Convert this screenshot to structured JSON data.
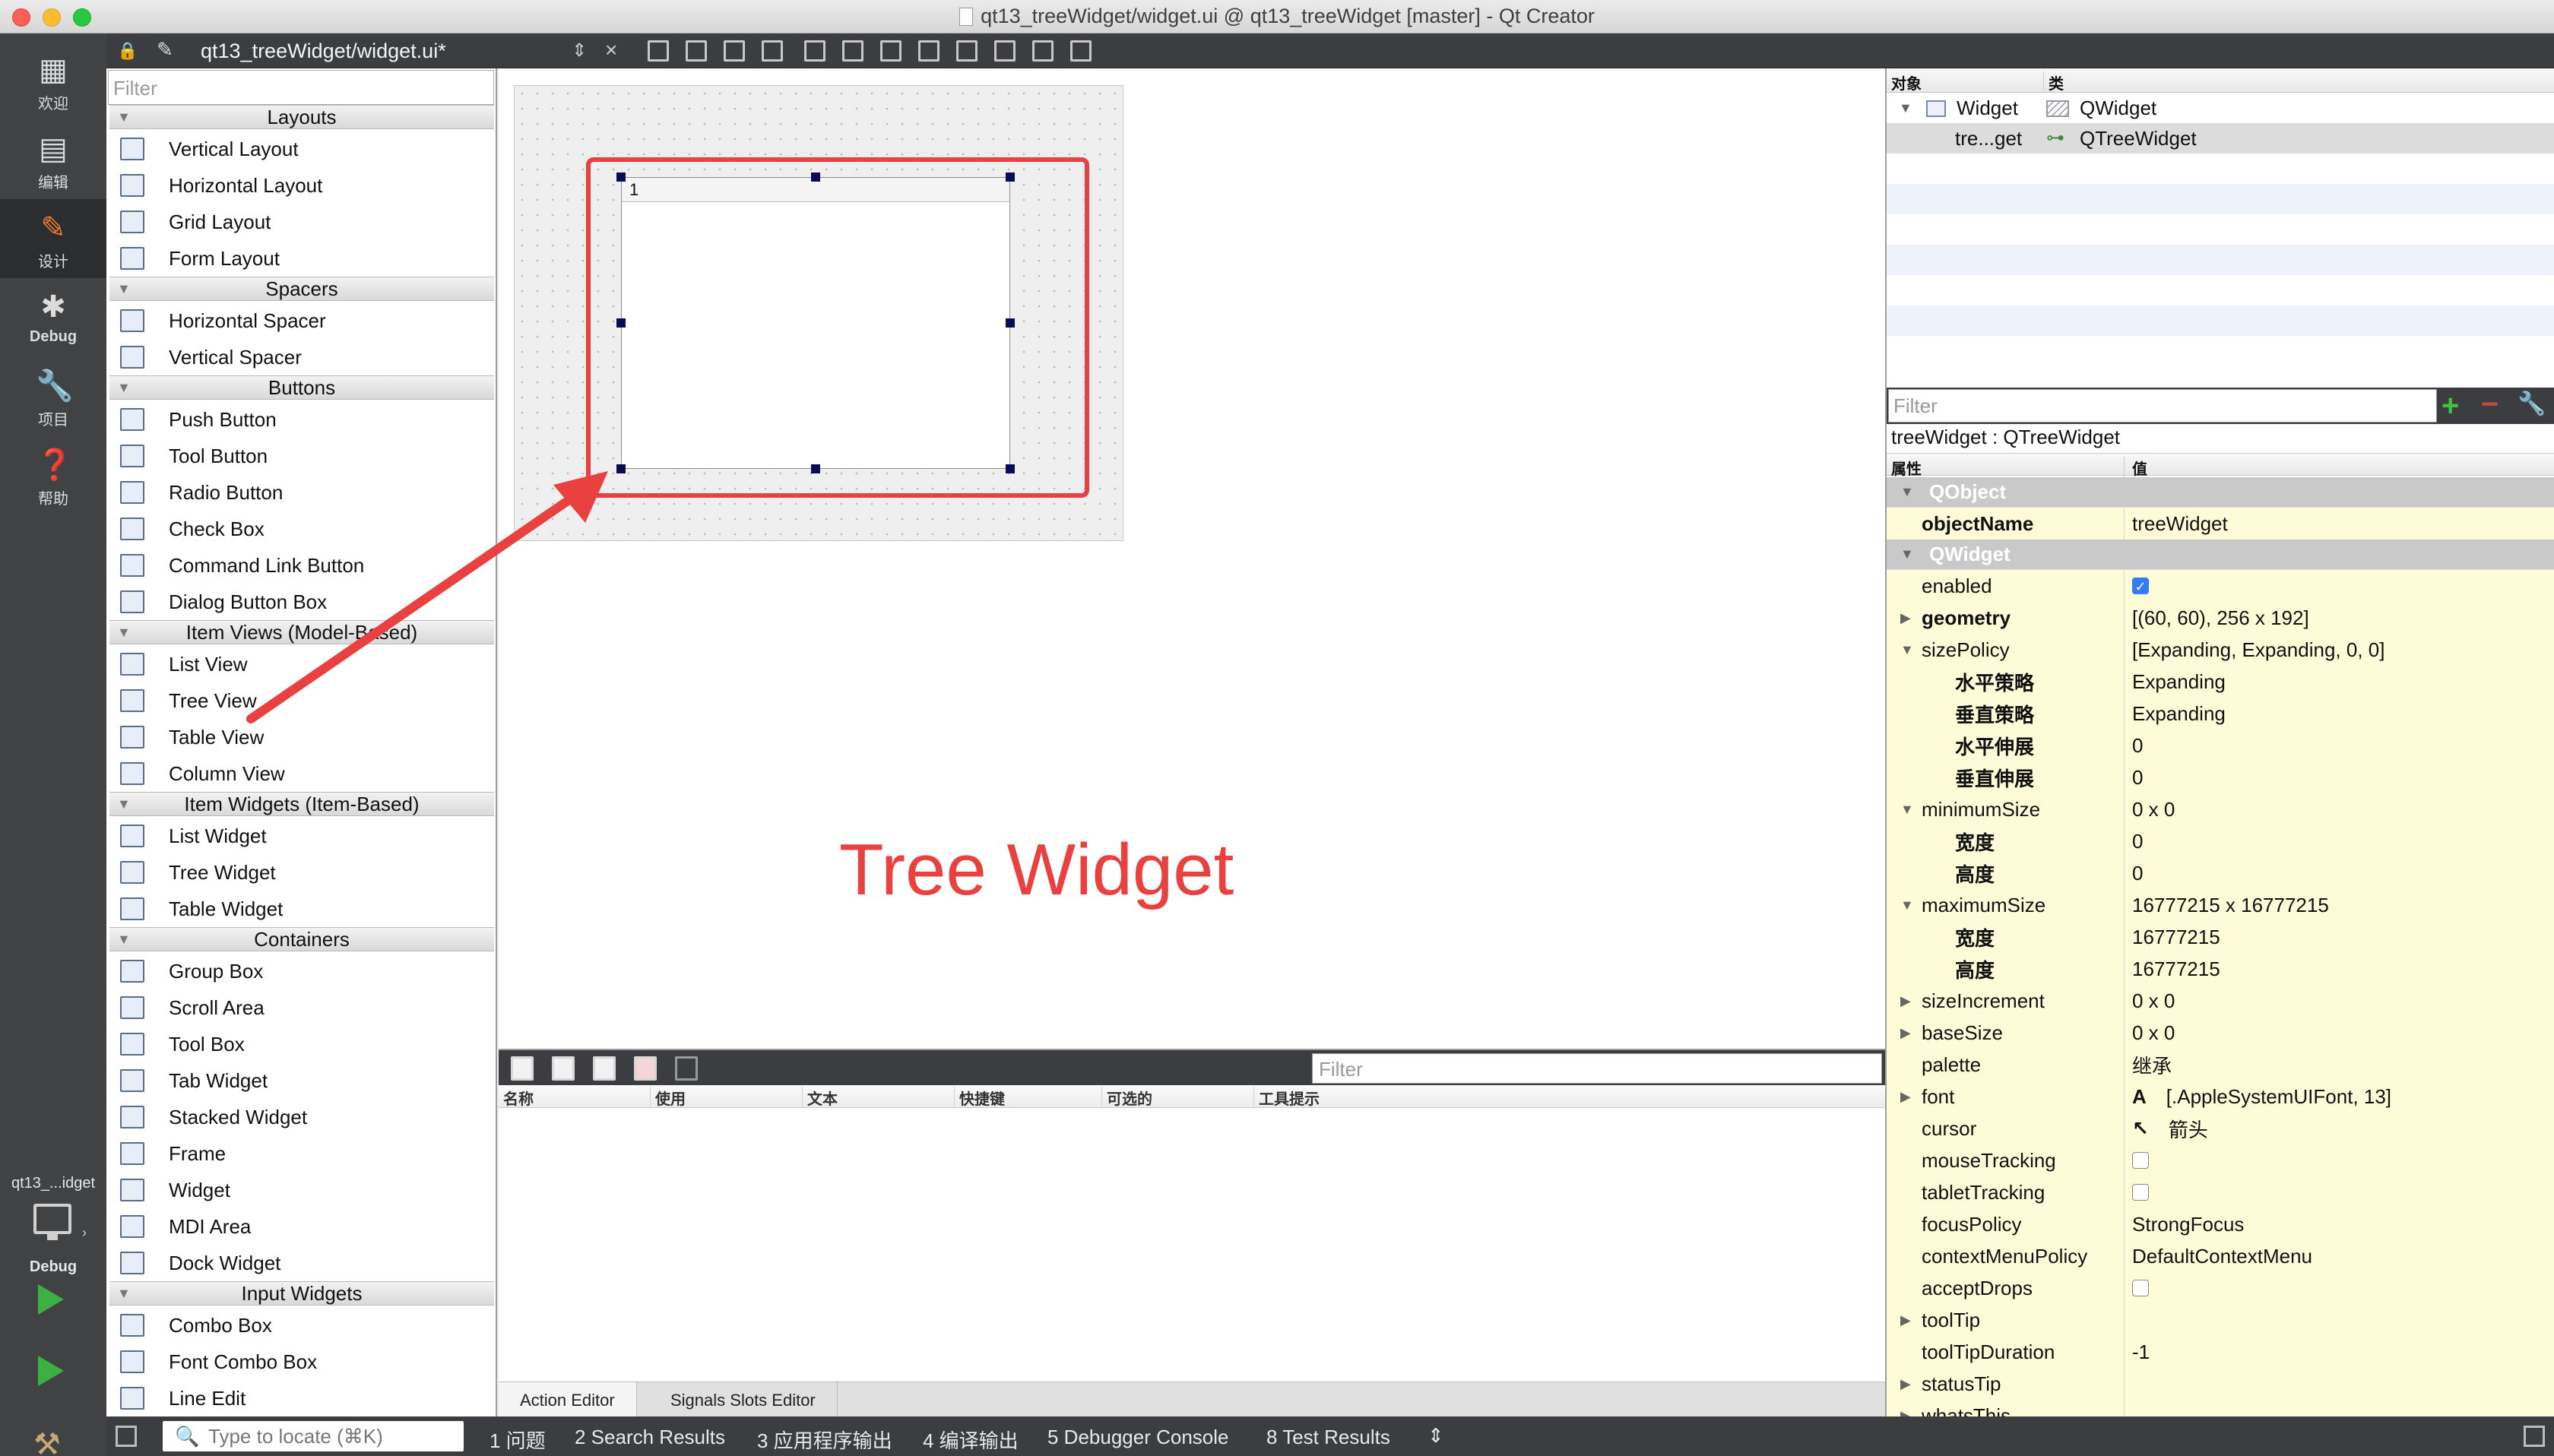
{
  "window": {
    "title": "qt13_treeWidget/widget.ui @ qt13_treeWidget [master] - Qt Creator"
  },
  "modebar": {
    "items": [
      {
        "label": "欢迎",
        "icon": "grid-icon"
      },
      {
        "label": "编辑",
        "icon": "document-icon"
      },
      {
        "label": "设计",
        "icon": "pencil-icon"
      },
      {
        "label": "Debug",
        "icon": "bug-icon"
      },
      {
        "label": "项目",
        "icon": "wrench-icon"
      },
      {
        "label": "帮助",
        "icon": "help-icon"
      }
    ],
    "kit_label": "qt13_...idget",
    "kit_mode": "Debug"
  },
  "toolbar": {
    "document": "qt13_treeWidget/widget.ui*"
  },
  "widgetbox": {
    "filter_placeholder": "Filter",
    "categories": [
      {
        "name": "Layouts",
        "items": [
          "Vertical Layout",
          "Horizontal Layout",
          "Grid Layout",
          "Form Layout"
        ]
      },
      {
        "name": "Spacers",
        "items": [
          "Horizontal Spacer",
          "Vertical Spacer"
        ]
      },
      {
        "name": "Buttons",
        "items": [
          "Push Button",
          "Tool Button",
          "Radio Button",
          "Check Box",
          "Command Link Button",
          "Dialog Button Box"
        ]
      },
      {
        "name": "Item Views (Model-Based)",
        "items": [
          "List View",
          "Tree View",
          "Table View",
          "Column View"
        ]
      },
      {
        "name": "Item Widgets (Item-Based)",
        "items": [
          "List Widget",
          "Tree Widget",
          "Table Widget"
        ]
      },
      {
        "name": "Containers",
        "items": [
          "Group Box",
          "Scroll Area",
          "Tool Box",
          "Tab Widget",
          "Stacked Widget",
          "Frame",
          "Widget",
          "MDI Area",
          "Dock Widget"
        ]
      },
      {
        "name": "Input Widgets",
        "items": [
          "Combo Box",
          "Font Combo Box",
          "Line Edit"
        ]
      }
    ]
  },
  "canvas": {
    "tree_header_col": "1",
    "annotation": "Tree Widget",
    "annotation_color": "#e8413f"
  },
  "action_editor": {
    "filter_placeholder": "Filter",
    "columns": [
      "名称",
      "使用",
      "文本",
      "快捷键",
      "可选的",
      "工具提示"
    ],
    "tabs": [
      "Action Editor",
      "Signals  Slots Editor"
    ]
  },
  "object_inspector": {
    "col_object": "对象",
    "col_class": "类",
    "rows": [
      {
        "object": "Widget",
        "class": "QWidget"
      },
      {
        "object": "tre...get",
        "class": "QTreeWidget"
      }
    ]
  },
  "property_editor": {
    "filter_placeholder": "Filter",
    "class_line": "treeWidget : QTreeWidget",
    "col_property": "属性",
    "col_value": "值",
    "rows": [
      {
        "kind": "group",
        "name": "QObject"
      },
      {
        "kind": "prop",
        "name": "objectName",
        "value": "treeWidget",
        "bold": true
      },
      {
        "kind": "group",
        "name": "QWidget"
      },
      {
        "kind": "prop",
        "name": "enabled",
        "check": true
      },
      {
        "kind": "prop",
        "name": "geometry",
        "value": "[(60, 60), 256 x 192]",
        "bold": true,
        "exp": "▶"
      },
      {
        "kind": "prop",
        "name": "sizePolicy",
        "value": "[Expanding, Expanding, 0, 0]",
        "exp": "▼"
      },
      {
        "kind": "sub",
        "name": "水平策略",
        "value": "Expanding"
      },
      {
        "kind": "sub",
        "name": "垂直策略",
        "value": "Expanding"
      },
      {
        "kind": "sub",
        "name": "水平伸展",
        "value": "0"
      },
      {
        "kind": "sub",
        "name": "垂直伸展",
        "value": "0"
      },
      {
        "kind": "prop",
        "name": "minimumSize",
        "value": "0 x 0",
        "exp": "▼"
      },
      {
        "kind": "sub",
        "name": "宽度",
        "value": "0"
      },
      {
        "kind": "sub",
        "name": "高度",
        "value": "0"
      },
      {
        "kind": "prop",
        "name": "maximumSize",
        "value": "16777215 x 16777215",
        "exp": "▼"
      },
      {
        "kind": "sub",
        "name": "宽度",
        "value": "16777215"
      },
      {
        "kind": "sub",
        "name": "高度",
        "value": "16777215"
      },
      {
        "kind": "prop",
        "name": "sizeIncrement",
        "value": "0 x 0",
        "exp": "▶"
      },
      {
        "kind": "prop",
        "name": "baseSize",
        "value": "0 x 0",
        "exp": "▶"
      },
      {
        "kind": "prop",
        "name": "palette",
        "value": "继承"
      },
      {
        "kind": "prop",
        "name": "font",
        "value": "[.AppleSystemUIFont, 13]",
        "prefix": "A",
        "exp": "▶"
      },
      {
        "kind": "prop",
        "name": "cursor",
        "value": "箭头",
        "prefix": "↖"
      },
      {
        "kind": "prop",
        "name": "mouseTracking",
        "check": false
      },
      {
        "kind": "prop",
        "name": "tabletTracking",
        "check": false
      },
      {
        "kind": "prop",
        "name": "focusPolicy",
        "value": "StrongFocus"
      },
      {
        "kind": "prop",
        "name": "contextMenuPolicy",
        "value": "DefaultContextMenu"
      },
      {
        "kind": "prop",
        "name": "acceptDrops",
        "check": false
      },
      {
        "kind": "prop",
        "name": "toolTip",
        "value": "",
        "exp": "▶"
      },
      {
        "kind": "prop",
        "name": "toolTipDuration",
        "value": "-1"
      },
      {
        "kind": "prop",
        "name": "statusTip",
        "value": "",
        "exp": "▶"
      },
      {
        "kind": "prop",
        "name": "whatsThis",
        "value": "",
        "exp": "▶"
      }
    ]
  },
  "statusbar": {
    "locate_placeholder": "Type to locate (⌘K)",
    "panes": [
      "1  问题",
      "2  Search Results",
      "3  应用程序输出",
      "4  编译输出",
      "5  Debugger Console",
      "8  Test Results"
    ]
  }
}
